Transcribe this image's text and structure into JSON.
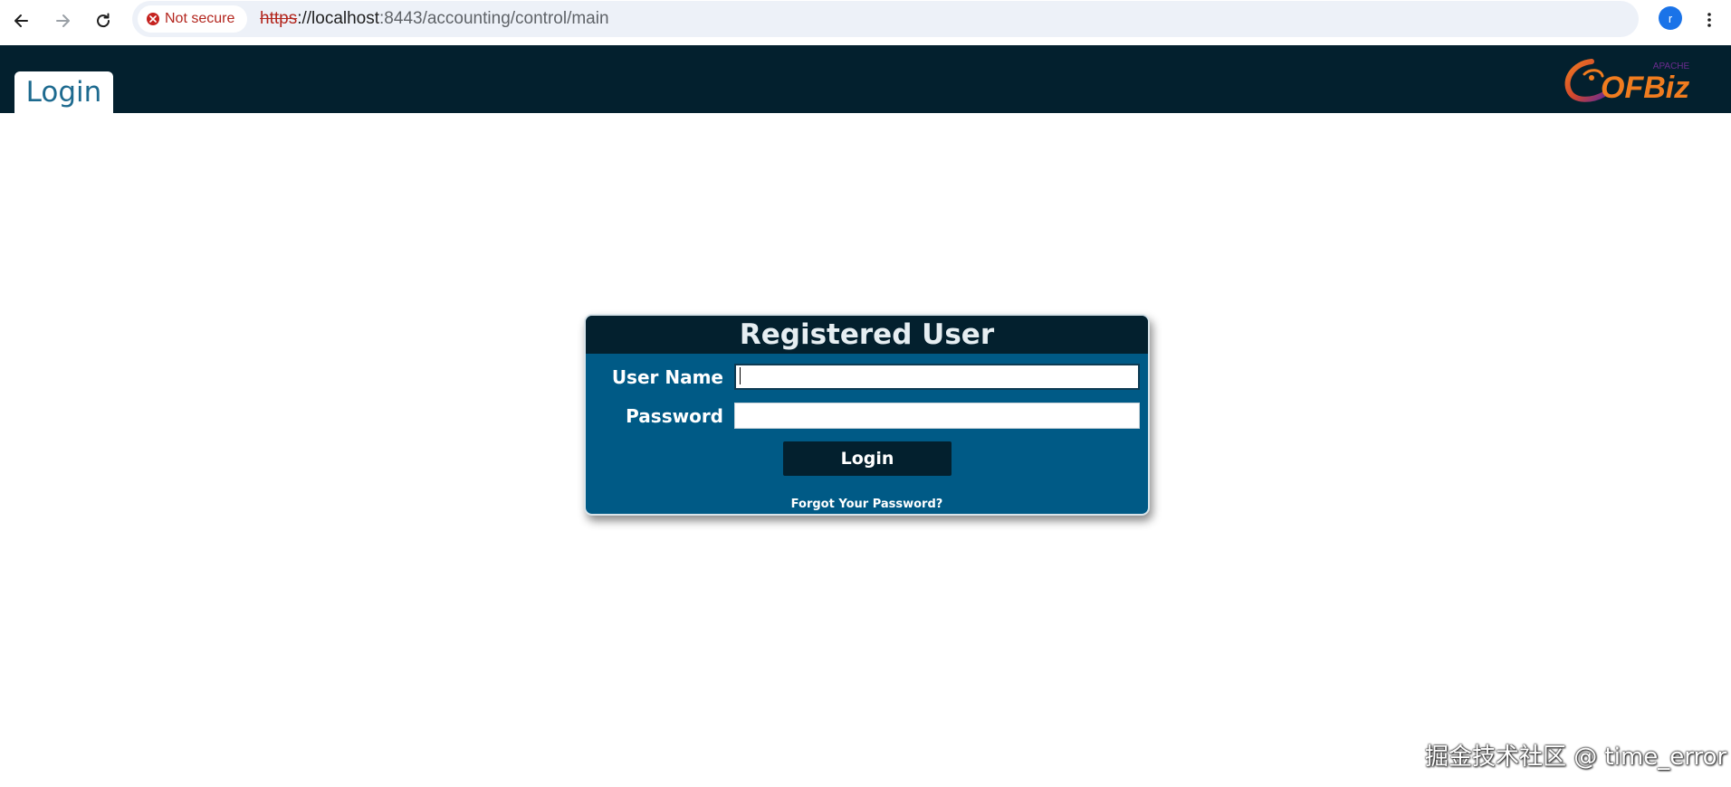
{
  "browser": {
    "security_label": "Not secure",
    "url_scheme": "https",
    "url_host": "://localhost",
    "url_path": ":8443/accounting/control/main",
    "profile_initial": "r"
  },
  "header": {
    "tab_label": "Login",
    "logo_text": "OFBiz",
    "logo_small_text": "APACHE"
  },
  "login_form": {
    "title": "Registered User",
    "username_label": "User Name",
    "username_value": "",
    "password_label": "Password",
    "password_value": "",
    "submit_label": "Login",
    "forgot_link": "Forgot Your Password?"
  },
  "watermark": "掘金技术社区 @ time_error",
  "colors": {
    "header_bg": "#03202e",
    "form_bg": "#005a86",
    "tab_text": "#1d6a8f",
    "not_secure_red": "#b3261e",
    "logo_orange": "#f07c1f",
    "logo_purple": "#6b2c8f"
  }
}
